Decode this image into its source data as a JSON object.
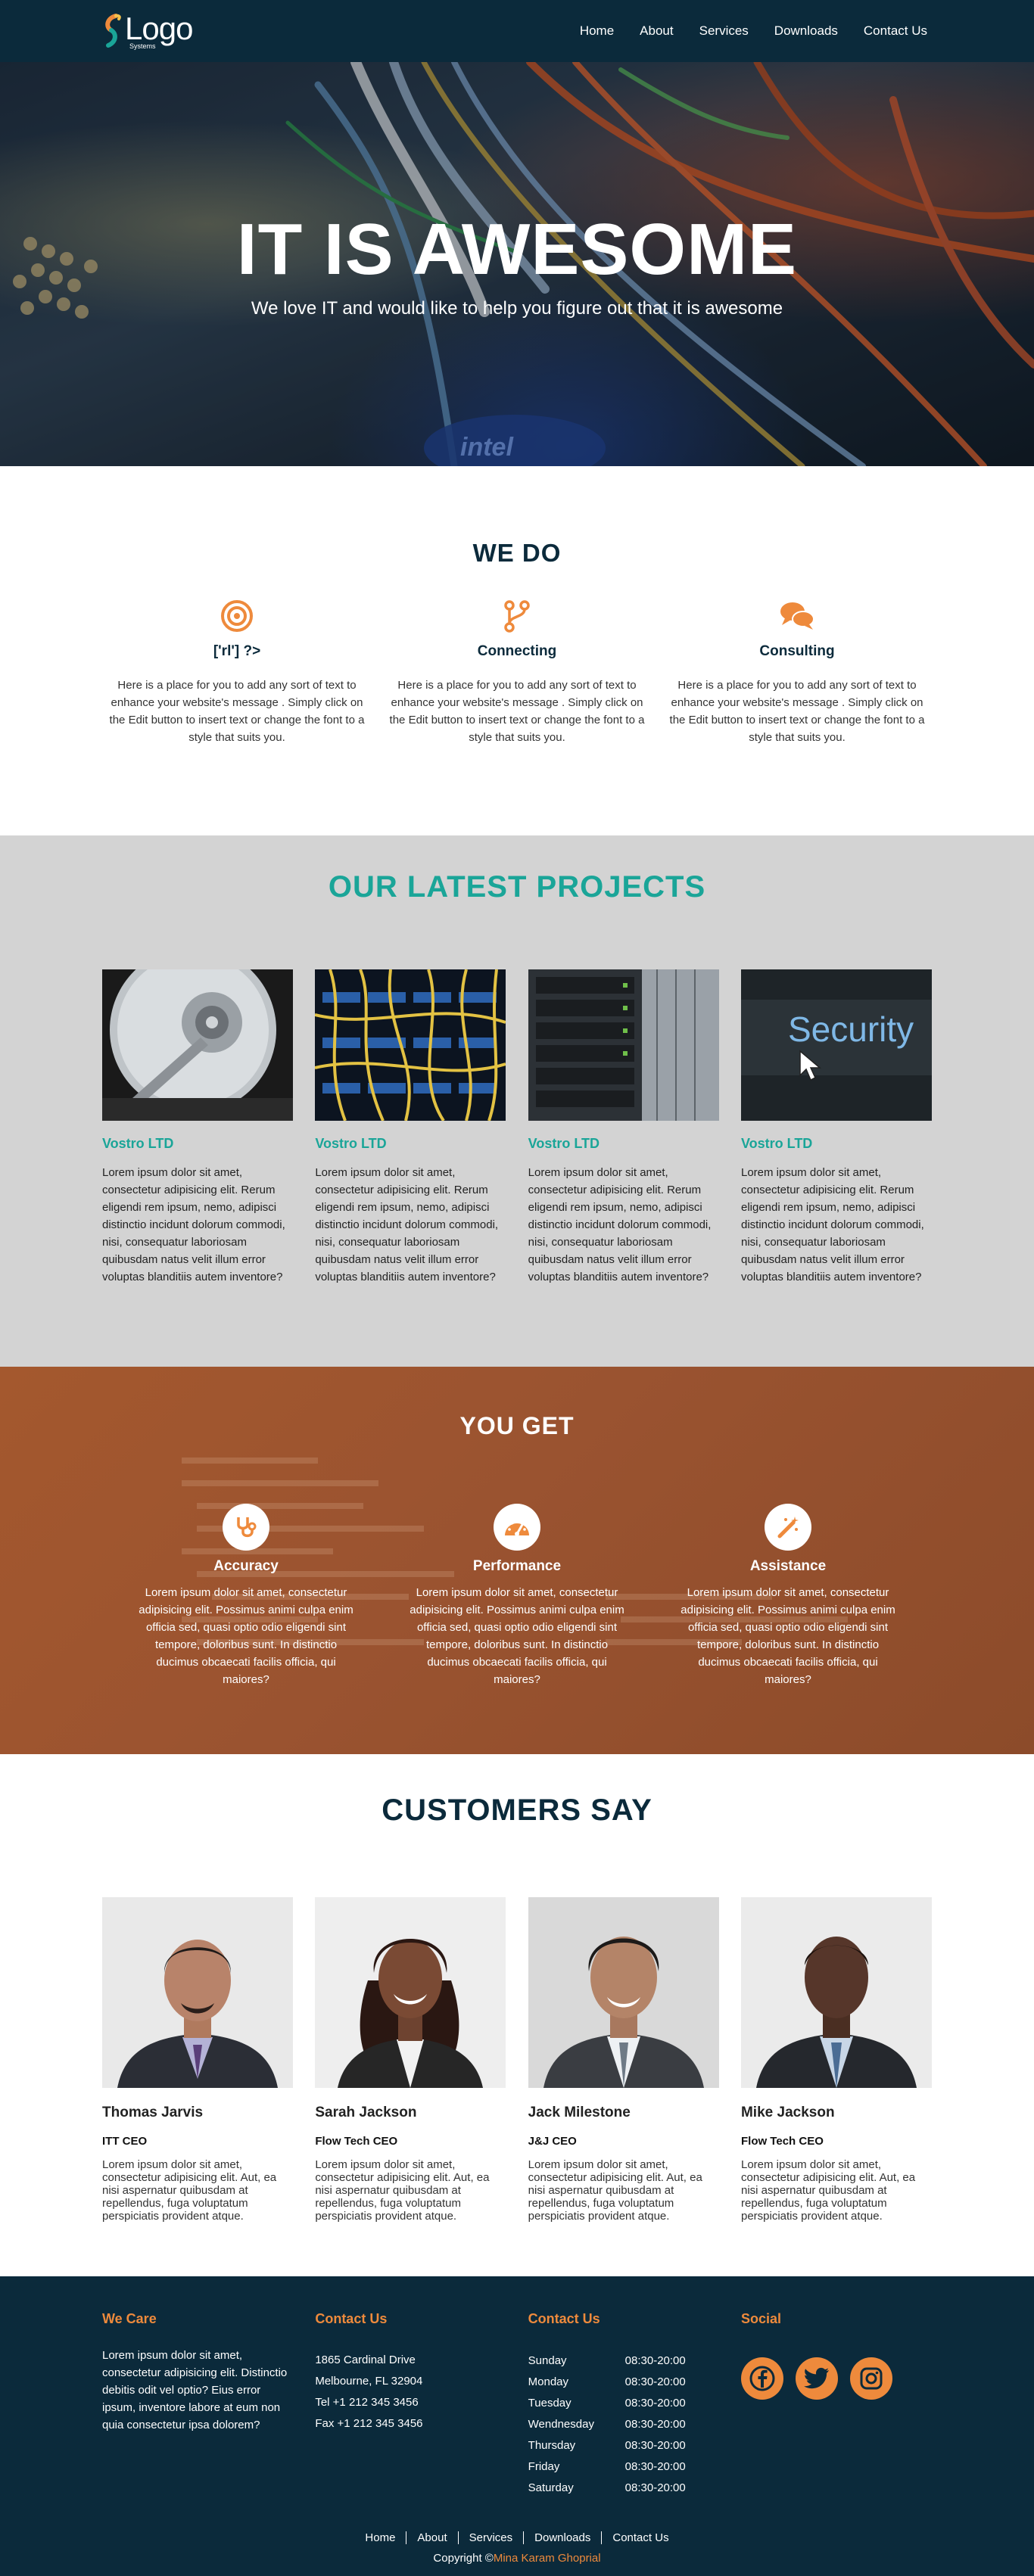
{
  "header": {
    "logo_text": "Logo",
    "logo_sub": "Systems",
    "nav": [
      "Home",
      "About",
      "Services",
      "Downloads",
      "Contact Us"
    ]
  },
  "hero": {
    "title": "IT IS AWESOME",
    "subtitle": "We love IT and would like to help you figure out that it is awesome",
    "chip_text": "intel"
  },
  "we_do": {
    "title": "WE DO",
    "items": [
      {
        "icon": "target-icon",
        "title": "['rl'] ?>",
        "text": "Here is a place for you to add any sort of text to enhance your website's message . Simply click on the Edit button to insert text or change the font to a style that suits you."
      },
      {
        "icon": "branch-icon",
        "title": "Connecting",
        "text": "Here is a place for you to add any sort of text to enhance your website's message . Simply click on the Edit button to insert text or change the font to a style that suits you."
      },
      {
        "icon": "chat-icon",
        "title": "Consulting",
        "text": "Here is a place for you to add any sort of text to enhance your website's message . Simply click on the Edit button to insert text or change the font to a style that suits you."
      }
    ]
  },
  "projects": {
    "title": "OUR LATEST PROJECTS",
    "items": [
      {
        "image": "hard-drive-image",
        "title": "Vostro LTD",
        "text": "Lorem ipsum dolor sit amet, consectetur adipisicing elit. Rerum eligendi rem ipsum, nemo, adipisci distinctio incidunt dolorum commodi, nisi, consequatur laboriosam quibusdam natus velit illum error voluptas blanditiis autem inventore?"
      },
      {
        "image": "network-cables-image",
        "title": "Vostro LTD",
        "text": "Lorem ipsum dolor sit amet, consectetur adipisicing elit. Rerum eligendi rem ipsum, nemo, adipisci distinctio incidunt dolorum commodi, nisi, consequatur laboriosam quibusdam natus velit illum error voluptas blanditiis autem inventore?"
      },
      {
        "image": "server-rack-image",
        "title": "Vostro LTD",
        "text": "Lorem ipsum dolor sit amet, consectetur adipisicing elit. Rerum eligendi rem ipsum, nemo, adipisci distinctio incidunt dolorum commodi, nisi, consequatur laboriosam quibusdam natus velit illum error voluptas blanditiis autem inventore?"
      },
      {
        "image": "security-key-image",
        "image_text": "Security",
        "title": "Vostro LTD",
        "text": "Lorem ipsum dolor sit amet, consectetur adipisicing elit. Rerum eligendi rem ipsum, nemo, adipisci distinctio incidunt dolorum commodi, nisi, consequatur laboriosam quibusdam natus velit illum error voluptas blanditiis autem inventore?"
      }
    ]
  },
  "you_get": {
    "title": "YOU GET",
    "items": [
      {
        "icon": "stethoscope-icon",
        "title": "Accuracy",
        "text": "Lorem ipsum dolor sit amet, consectetur adipisicing elit. Possimus animi culpa enim officia sed, quasi optio odio eligendi sint tempore, doloribus sunt. In distinctio ducimus obcaecati facilis officia, qui maiores?"
      },
      {
        "icon": "speedometer-icon",
        "title": "Performance",
        "text": "Lorem ipsum dolor sit amet, consectetur adipisicing elit. Possimus animi culpa enim officia sed, quasi optio odio eligendi sint tempore, doloribus sunt. In distinctio ducimus obcaecati facilis officia, qui maiores?"
      },
      {
        "icon": "magic-wand-icon",
        "title": "Assistance",
        "text": "Lorem ipsum dolor sit amet, consectetur adipisicing elit. Possimus animi culpa enim officia sed, quasi optio odio eligendi sint tempore, doloribus sunt. In distinctio ducimus obcaecati facilis officia, qui maiores?"
      }
    ]
  },
  "customers": {
    "title": "CUSTOMERS SAY",
    "items": [
      {
        "name": "Thomas Jarvis",
        "role": "ITT CEO",
        "text": "Lorem ipsum dolor sit amet, consectetur adipisicing elit. Aut, ea nisi aspernatur quibusdam at repellendus, fuga voluptatum perspiciatis provident atque."
      },
      {
        "name": "Sarah Jackson",
        "role": "Flow Tech CEO",
        "text": "Lorem ipsum dolor sit amet, consectetur adipisicing elit. Aut, ea nisi aspernatur quibusdam at repellendus, fuga voluptatum perspiciatis provident atque."
      },
      {
        "name": "Jack Milestone",
        "role": "J&J CEO",
        "text": "Lorem ipsum dolor sit amet, consectetur adipisicing elit. Aut, ea nisi aspernatur quibusdam at repellendus, fuga voluptatum perspiciatis provident atque."
      },
      {
        "name": "Mike Jackson",
        "role": "Flow Tech CEO",
        "text": "Lorem ipsum dolor sit amet, consectetur adipisicing elit. Aut, ea nisi aspernatur quibusdam at repellendus, fuga voluptatum perspiciatis provident atque."
      }
    ]
  },
  "footer": {
    "we_care": {
      "heading": "We Care",
      "text": "Lorem ipsum dolor sit amet, consectetur adipisicing elit. Distinctio debitis odit vel optio? Eius error ipsum, inventore labore at eum non quia consectetur ipsa dolorem?"
    },
    "contact": {
      "heading": "Contact Us",
      "lines": [
        "1865 Cardinal Drive",
        "Melbourne, FL 32904",
        "Tel +1 212 345 3456",
        "Fax +1 212 345 3456"
      ]
    },
    "hours": {
      "heading": "Contact Us",
      "rows": [
        {
          "day": "Sunday",
          "time": "08:30-20:00"
        },
        {
          "day": "Monday",
          "time": "08:30-20:00"
        },
        {
          "day": "Tuesday",
          "time": "08:30-20:00"
        },
        {
          "day": "Wendnesday",
          "time": "08:30-20:00"
        },
        {
          "day": "Thursday",
          "time": "08:30-20:00"
        },
        {
          "day": "Friday",
          "time": "08:30-20:00"
        },
        {
          "day": "Saturday",
          "time": "08:30-20:00"
        }
      ]
    },
    "social": {
      "heading": "Social",
      "icons": [
        "facebook-icon",
        "twitter-icon",
        "instagram-icon"
      ]
    },
    "nav": [
      "Home",
      "About",
      "Services",
      "Downloads",
      "Contact Us"
    ],
    "copyright_prefix": "Copyright ©",
    "copyright_author": "Mina Karam Ghoprial"
  },
  "colors": {
    "navy": "#0b2a3b",
    "teal": "#1aa598",
    "orange": "#ee8a3c",
    "brown": "#9a5330",
    "gray": "#d3d3d3"
  }
}
